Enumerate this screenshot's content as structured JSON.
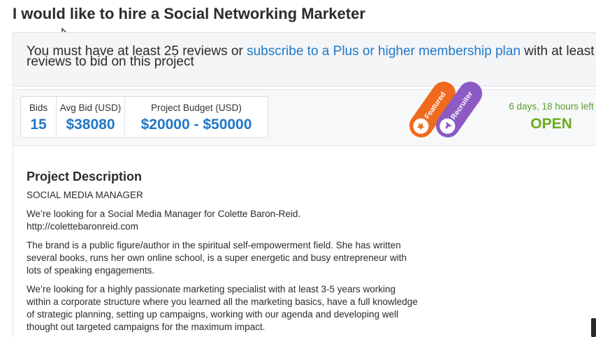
{
  "page": {
    "title": "I would like to hire a Social Networking Marketer"
  },
  "notice": {
    "text_before": "You must have at least 25 reviews or ",
    "link_text": "subscribe to a Plus or higher membership plan",
    "text_after": " with at least",
    "line2": "reviews to bid on this project"
  },
  "stats": {
    "bids_label": "Bids",
    "bids_value": "15",
    "avg_label": "Avg Bid (USD)",
    "avg_value": "$38080",
    "budget_label": "Project Budget (USD)",
    "budget_value": "$20000 - $50000"
  },
  "badges": {
    "featured": "Featured",
    "recruiter": "Recruiter",
    "featured_color": "#f06a1e",
    "recruiter_color": "#8d5ac4",
    "featured_icon": "star-icon",
    "recruiter_icon": "recruiter-icon"
  },
  "status": {
    "time_left": "6 days, 18 hours left",
    "state": "OPEN",
    "color": "#6aab1f"
  },
  "description": {
    "heading": "Project Description",
    "subheading": "SOCIAL MEDIA MANAGER",
    "p1": "We’re looking for a Social Media Manager for Colette Baron-Reid.",
    "p1_link": "http://colettebaronreid.com",
    "p2": "The brand is a public figure/author in the spiritual self-empowerment field. She has written several books, runs her own online school, is a super energetic and busy entrepreneur with lots of speaking engagements.",
    "p3": "We’re looking for a highly passionate marketing specialist with at least 3-5 years working within a corporate structure where you learned all the marketing basics, have a full knowledge of strategic planning, setting up campaigns, working with our agenda and developing well thought out targeted campaigns for the maximum impact."
  },
  "colors": {
    "link": "#1f78c8",
    "accent_blue": "#1f78c8"
  }
}
